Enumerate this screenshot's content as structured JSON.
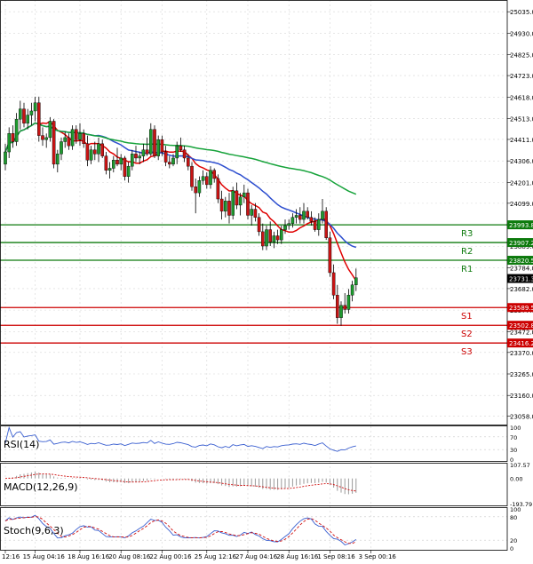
{
  "chart_data": {
    "type": "candlestick",
    "price_axis": {
      "ylim": [
        23035,
        25075
      ],
      "ticks": [
        "25035.0",
        "24930.0",
        "24825.0",
        "24723.0",
        "24618.0",
        "24513.0",
        "24411.0",
        "24306.0",
        "24201.0",
        "24099.0",
        "23994.0",
        "23889.0",
        "23784.0",
        "23682.0",
        "23577.0",
        "23472.0",
        "23370.0",
        "23265.0",
        "23160.0",
        "23058.0"
      ]
    },
    "x_axis": {
      "labels": [
        "12:16",
        "15 Aug 04:16",
        "18 Aug 16:16",
        "20 Aug 08:16",
        "22 Aug 00:16",
        "25 Aug 12:16",
        "27 Aug 04:16",
        "28 Aug 16:16",
        "1 Sep 08:16",
        "3 Sep 00:16"
      ],
      "label_index": [
        0,
        8,
        20,
        31,
        42,
        54,
        65,
        76,
        87,
        98
      ]
    },
    "candles": [
      [
        24290,
        24390,
        24260,
        24350
      ],
      [
        24350,
        24470,
        24320,
        24440
      ],
      [
        24440,
        24480,
        24370,
        24400
      ],
      [
        24400,
        24540,
        24380,
        24510
      ],
      [
        24510,
        24600,
        24460,
        24560
      ],
      [
        24560,
        24590,
        24470,
        24490
      ],
      [
        24490,
        24560,
        24460,
        24530
      ],
      [
        24530,
        24590,
        24480,
        24550
      ],
      [
        24550,
        24620,
        24500,
        24590
      ],
      [
        24590,
        24620,
        24400,
        24430
      ],
      [
        24430,
        24470,
        24380,
        24410
      ],
      [
        24410,
        24440,
        24370,
        24420
      ],
      [
        24420,
        24520,
        24400,
        24500
      ],
      [
        24500,
        24510,
        24270,
        24290
      ],
      [
        24290,
        24360,
        24250,
        24340
      ],
      [
        24340,
        24420,
        24310,
        24400
      ],
      [
        24400,
        24450,
        24370,
        24420
      ],
      [
        24420,
        24440,
        24360,
        24380
      ],
      [
        24380,
        24480,
        24360,
        24460
      ],
      [
        24460,
        24480,
        24390,
        24410
      ],
      [
        24410,
        24490,
        24380,
        24440
      ],
      [
        24440,
        24460,
        24370,
        24390
      ],
      [
        24390,
        24430,
        24280,
        24310
      ],
      [
        24310,
        24380,
        24290,
        24360
      ],
      [
        24360,
        24400,
        24310,
        24340
      ],
      [
        24340,
        24420,
        24300,
        24390
      ],
      [
        24390,
        24410,
        24320,
        24330
      ],
      [
        24330,
        24350,
        24240,
        24260
      ],
      [
        24260,
        24300,
        24220,
        24270
      ],
      [
        24270,
        24330,
        24250,
        24310
      ],
      [
        24310,
        24370,
        24280,
        24290
      ],
      [
        24290,
        24340,
        24260,
        24320
      ],
      [
        24320,
        24330,
        24210,
        24230
      ],
      [
        24230,
        24300,
        24200,
        24280
      ],
      [
        24280,
        24360,
        24260,
        24340
      ],
      [
        24340,
        24380,
        24300,
        24320
      ],
      [
        24320,
        24350,
        24290,
        24330
      ],
      [
        24330,
        24390,
        24300,
        24360
      ],
      [
        24360,
        24420,
        24330,
        24340
      ],
      [
        24340,
        24490,
        24330,
        24460
      ],
      [
        24460,
        24480,
        24320,
        24330
      ],
      [
        24330,
        24430,
        24310,
        24410
      ],
      [
        24410,
        24430,
        24330,
        24350
      ],
      [
        24350,
        24380,
        24280,
        24300
      ],
      [
        24300,
        24330,
        24270,
        24290
      ],
      [
        24290,
        24340,
        24280,
        24320
      ],
      [
        24320,
        24400,
        24290,
        24380
      ],
      [
        24380,
        24420,
        24350,
        24360
      ],
      [
        24360,
        24380,
        24300,
        24320
      ],
      [
        24320,
        24340,
        24260,
        24280
      ],
      [
        24280,
        24300,
        24160,
        24180
      ],
      [
        24180,
        24220,
        24050,
        24150
      ],
      [
        24150,
        24230,
        24130,
        24210
      ],
      [
        24210,
        24260,
        24190,
        24230
      ],
      [
        24230,
        24250,
        24170,
        24190
      ],
      [
        24190,
        24280,
        24170,
        24260
      ],
      [
        24260,
        24270,
        24200,
        24220
      ],
      [
        24220,
        24240,
        24100,
        24120
      ],
      [
        24120,
        24160,
        24020,
        24060
      ],
      [
        24060,
        24130,
        24030,
        24110
      ],
      [
        24110,
        24150,
        24000,
        24040
      ],
      [
        24040,
        24180,
        24020,
        24160
      ],
      [
        24160,
        24200,
        24070,
        24090
      ],
      [
        24090,
        24150,
        24040,
        24130
      ],
      [
        24130,
        24190,
        24100,
        24150
      ],
      [
        24150,
        24170,
        24020,
        24040
      ],
      [
        24040,
        24090,
        23990,
        24070
      ],
      [
        24070,
        24100,
        24010,
        24030
      ],
      [
        24030,
        24050,
        23940,
        23960
      ],
      [
        23960,
        24000,
        23870,
        23890
      ],
      [
        23890,
        23990,
        23870,
        23970
      ],
      [
        23970,
        24010,
        23890,
        23910
      ],
      [
        23910,
        23960,
        23880,
        23940
      ],
      [
        23940,
        23970,
        23900,
        23920
      ],
      [
        23920,
        23990,
        23900,
        23970
      ],
      [
        23970,
        24020,
        23950,
        23990
      ],
      [
        23990,
        24020,
        23970,
        24000
      ],
      [
        24000,
        24050,
        23980,
        24030
      ],
      [
        24030,
        24070,
        24000,
        24040
      ],
      [
        24040,
        24080,
        24000,
        24020
      ],
      [
        24020,
        24100,
        24000,
        24060
      ],
      [
        24060,
        24080,
        24020,
        24030
      ],
      [
        24030,
        24060,
        23990,
        24010
      ],
      [
        24010,
        24030,
        23960,
        23970
      ],
      [
        23970,
        24050,
        23940,
        24020
      ],
      [
        24020,
        24120,
        24000,
        24060
      ],
      [
        24060,
        24080,
        23920,
        23930
      ],
      [
        23930,
        23960,
        23740,
        23760
      ],
      [
        23760,
        23800,
        23630,
        23650
      ],
      [
        23650,
        23700,
        23510,
        23540
      ],
      [
        23540,
        23620,
        23500,
        23600
      ],
      [
        23600,
        23660,
        23560,
        23580
      ],
      [
        23580,
        23680,
        23560,
        23650
      ],
      [
        23650,
        23720,
        23620,
        23700
      ],
      [
        23700,
        23780,
        23670,
        23735
      ]
    ],
    "series": [
      {
        "name": "",
        "color": "#e00000"
      },
      {
        "name": "",
        "color": "#2e4fcf"
      },
      {
        "name": "",
        "color": "#17a33b"
      }
    ],
    "levels": [
      {
        "label": "R3",
        "value": 23993.8,
        "text": "23993.8",
        "color": "#0d7a0d"
      },
      {
        "label": "R2",
        "value": 23907.2,
        "text": "23907.2",
        "color": "#0d7a0d"
      },
      {
        "label": "R1",
        "value": 23820.5,
        "text": "23820.5",
        "color": "#0d7a0d"
      },
      {
        "label": "",
        "value": 23731.3,
        "text": "23731.3",
        "color": "#000000"
      },
      {
        "label": "S1",
        "value": 23589.5,
        "text": "23589.5",
        "color": "#cc0000"
      },
      {
        "label": "S2",
        "value": 23502.8,
        "text": "23502.8",
        "color": "#cc0000"
      },
      {
        "label": "S3",
        "value": 23416.2,
        "text": "23416.2",
        "color": "#cc0000"
      }
    ],
    "indicators": {
      "rsi": {
        "label": "RSI(14)",
        "ticks": [
          "100",
          "70",
          "30",
          "0"
        ],
        "ylim": [
          0,
          100
        ]
      },
      "macd": {
        "label": "MACD(12,26,9)",
        "ticks": [
          "107.57",
          "0.00",
          "-193.79"
        ],
        "ylim": [
          -193.79,
          107.57
        ]
      },
      "stoch": {
        "label": "Stoch(9,6,3)",
        "ticks": [
          "100",
          "80",
          "20",
          "0"
        ],
        "ylim": [
          0,
          100
        ]
      }
    }
  }
}
